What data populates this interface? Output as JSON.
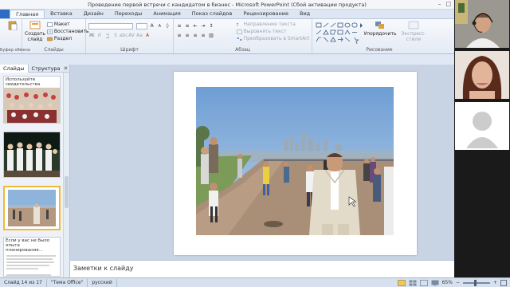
{
  "window": {
    "title": "Проведение первой встречи с кандидатом в бизнес - Microsoft PowerPoint (Сбой активации продукта)"
  },
  "tabs": [
    "Главная",
    "Вставка",
    "Дизайн",
    "Переходы",
    "Анимация",
    "Показ слайдов",
    "Рецензирование",
    "Вид"
  ],
  "ribbon": {
    "clipboard": {
      "label": "Буфер обмена"
    },
    "slides": {
      "new_slide": "Создать слайд",
      "layout": "Макет",
      "reset": "Восстановить",
      "section": "Раздел",
      "label": "Слайды"
    },
    "font": {
      "label": "Шрифт"
    },
    "paragraph": {
      "text_direction": "Направление текста",
      "align_text": "Выровнять текст",
      "smartart": "Преобразовать в SmartArt",
      "label": "Абзац"
    },
    "drawing": {
      "arrange": "Упорядочить",
      "quick_styles": "Экспресс-стили",
      "label": "Рисование"
    }
  },
  "left_panel": {
    "tabs": [
      "Слайды",
      "Структура"
    ],
    "thumbs": [
      {
        "caption": "Используйте свидетельства"
      },
      {
        "caption": ""
      },
      {
        "caption": ""
      },
      {
        "caption": "Если у вас не было опыта планирования..."
      }
    ]
  },
  "notes": {
    "placeholder": "Заметки к слайду"
  },
  "status": {
    "slide": "Слайд 14 из 17",
    "theme": "\"Тема Office\"",
    "lang": "русский",
    "zoom": "65%"
  },
  "colors": {
    "file_tab": "#2e6cc4",
    "selected_thumb": "#f0b93a",
    "sky": "#8fb4dc"
  }
}
